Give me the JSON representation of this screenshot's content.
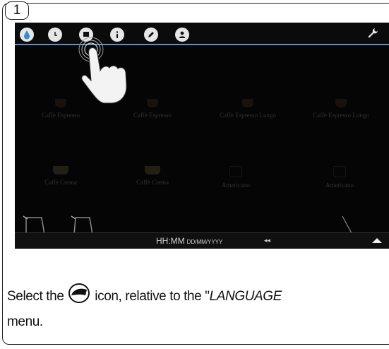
{
  "step": {
    "number": "1"
  },
  "toolbar": {
    "icons": [
      "water-drop-icon",
      "clock-icon",
      "flag-icon",
      "info-icon",
      "pencil-icon",
      "user-icon"
    ],
    "settings_icon": "wrench-icon",
    "accent": "#5c93c9"
  },
  "beverages": [
    "Caffè Espresso",
    "Caffè Espresso",
    "Caffè Espresso Lungo",
    "Caffè Espresso Lungo",
    "Caffè Crema",
    "Caffè Crema",
    "Americano",
    "Americano"
  ],
  "statusbar": {
    "time": "HH:MM",
    "date": "DD/MM/YYYY",
    "volume_icon": "speaker-icon",
    "expand_icon": "arrow-up-icon"
  },
  "caption": {
    "part1": "Select the",
    "part2": " icon, relative to the \"",
    "menu_name": "LANGUAGE",
    "part3": "menu."
  }
}
